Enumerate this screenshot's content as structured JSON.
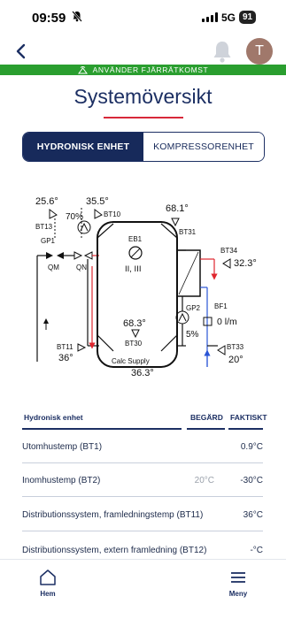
{
  "status_bar": {
    "time": "09:59",
    "network": "5G",
    "battery": "91"
  },
  "header": {
    "avatar_initial": "T",
    "banner_text": "ANVÄNDER FJÄRRÄTKOMST"
  },
  "page": {
    "title": "Systemöversikt"
  },
  "tabs": [
    {
      "label": "HYDRONISK ENHET",
      "active": true
    },
    {
      "label": "KOMPRESSORENHET",
      "active": false
    }
  ],
  "diagram": {
    "bt13_value": "25.6°",
    "bt13_label": "BT13",
    "bt10_value": "35.5°",
    "bt10_label": "BT10",
    "gp1_percent": "70%",
    "gp1_label": "GP1",
    "qm_label": "QM",
    "qn_label": "QN",
    "eb1_label": "EB1",
    "eb1_stages": "II, III",
    "tank_temp": "68.3°",
    "bt30_label": "BT30",
    "bt31_value": "68.1°",
    "bt31_label": "BT31",
    "bt34_label": "BT34",
    "bt34_value": "32.3°",
    "bf1_label": "BF1",
    "bf1_flow": "0 l/m",
    "gp2_label": "GP2",
    "gp2_percent": "5%",
    "bt11_label": "BT11",
    "bt11_value": "36°",
    "bt33_label": "BT33",
    "bt33_value": "20°",
    "calc_supply_label": "Calc Supply",
    "calc_supply_value": "36.3°"
  },
  "table": {
    "headers": {
      "name": "Hydronisk enhet",
      "requested": "BEGÄRD",
      "actual": "FAKTISKT"
    },
    "rows": [
      {
        "name": "Utomhustemp (BT1)",
        "requested": "",
        "actual": "0.9°C"
      },
      {
        "name": "Inomhustemp (BT2)",
        "requested": "20°C",
        "actual": "-30°C"
      },
      {
        "name": "Distributionssystem, framledningstemp (BT11)",
        "requested": "",
        "actual": "36°C"
      },
      {
        "name": "Distributionssystem, extern framledning (BT12)",
        "requested": "",
        "actual": "-°C"
      }
    ]
  },
  "bottom_nav": {
    "home_label": "Hem",
    "menu_label": "Meny"
  },
  "colors": {
    "navy": "#172a5b",
    "accent_red": "#d8293a",
    "banner_green": "#2a9e2f",
    "pipe_red": "#e0262e",
    "pipe_blue": "#2a55d6"
  },
  "icons": [
    "back-chevron-icon",
    "bell-icon",
    "muted-bell-icon",
    "home-icon",
    "menu-icon",
    "remote-access-icon"
  ]
}
